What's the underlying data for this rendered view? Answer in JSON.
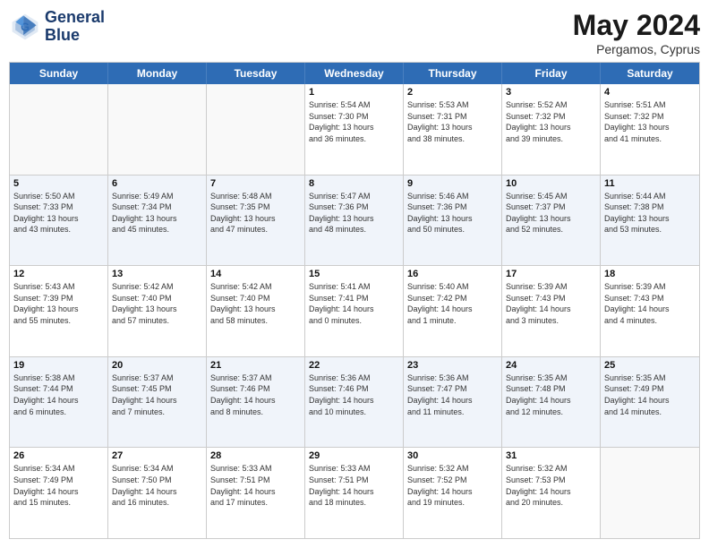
{
  "header": {
    "logo_line1": "General",
    "logo_line2": "Blue",
    "month": "May 2024",
    "location": "Pergamos, Cyprus"
  },
  "day_headers": [
    "Sunday",
    "Monday",
    "Tuesday",
    "Wednesday",
    "Thursday",
    "Friday",
    "Saturday"
  ],
  "weeks": [
    [
      {
        "day": "",
        "info": "",
        "empty": true
      },
      {
        "day": "",
        "info": "",
        "empty": true
      },
      {
        "day": "",
        "info": "",
        "empty": true
      },
      {
        "day": "1",
        "info": "Sunrise: 5:54 AM\nSunset: 7:30 PM\nDaylight: 13 hours\nand 36 minutes."
      },
      {
        "day": "2",
        "info": "Sunrise: 5:53 AM\nSunset: 7:31 PM\nDaylight: 13 hours\nand 38 minutes."
      },
      {
        "day": "3",
        "info": "Sunrise: 5:52 AM\nSunset: 7:32 PM\nDaylight: 13 hours\nand 39 minutes."
      },
      {
        "day": "4",
        "info": "Sunrise: 5:51 AM\nSunset: 7:32 PM\nDaylight: 13 hours\nand 41 minutes."
      }
    ],
    [
      {
        "day": "5",
        "info": "Sunrise: 5:50 AM\nSunset: 7:33 PM\nDaylight: 13 hours\nand 43 minutes.",
        "shaded": true
      },
      {
        "day": "6",
        "info": "Sunrise: 5:49 AM\nSunset: 7:34 PM\nDaylight: 13 hours\nand 45 minutes.",
        "shaded": true
      },
      {
        "day": "7",
        "info": "Sunrise: 5:48 AM\nSunset: 7:35 PM\nDaylight: 13 hours\nand 47 minutes.",
        "shaded": true
      },
      {
        "day": "8",
        "info": "Sunrise: 5:47 AM\nSunset: 7:36 PM\nDaylight: 13 hours\nand 48 minutes.",
        "shaded": true
      },
      {
        "day": "9",
        "info": "Sunrise: 5:46 AM\nSunset: 7:36 PM\nDaylight: 13 hours\nand 50 minutes.",
        "shaded": true
      },
      {
        "day": "10",
        "info": "Sunrise: 5:45 AM\nSunset: 7:37 PM\nDaylight: 13 hours\nand 52 minutes.",
        "shaded": true
      },
      {
        "day": "11",
        "info": "Sunrise: 5:44 AM\nSunset: 7:38 PM\nDaylight: 13 hours\nand 53 minutes.",
        "shaded": true
      }
    ],
    [
      {
        "day": "12",
        "info": "Sunrise: 5:43 AM\nSunset: 7:39 PM\nDaylight: 13 hours\nand 55 minutes."
      },
      {
        "day": "13",
        "info": "Sunrise: 5:42 AM\nSunset: 7:40 PM\nDaylight: 13 hours\nand 57 minutes."
      },
      {
        "day": "14",
        "info": "Sunrise: 5:42 AM\nSunset: 7:40 PM\nDaylight: 13 hours\nand 58 minutes."
      },
      {
        "day": "15",
        "info": "Sunrise: 5:41 AM\nSunset: 7:41 PM\nDaylight: 14 hours\nand 0 minutes."
      },
      {
        "day": "16",
        "info": "Sunrise: 5:40 AM\nSunset: 7:42 PM\nDaylight: 14 hours\nand 1 minute."
      },
      {
        "day": "17",
        "info": "Sunrise: 5:39 AM\nSunset: 7:43 PM\nDaylight: 14 hours\nand 3 minutes."
      },
      {
        "day": "18",
        "info": "Sunrise: 5:39 AM\nSunset: 7:43 PM\nDaylight: 14 hours\nand 4 minutes."
      }
    ],
    [
      {
        "day": "19",
        "info": "Sunrise: 5:38 AM\nSunset: 7:44 PM\nDaylight: 14 hours\nand 6 minutes.",
        "shaded": true
      },
      {
        "day": "20",
        "info": "Sunrise: 5:37 AM\nSunset: 7:45 PM\nDaylight: 14 hours\nand 7 minutes.",
        "shaded": true
      },
      {
        "day": "21",
        "info": "Sunrise: 5:37 AM\nSunset: 7:46 PM\nDaylight: 14 hours\nand 8 minutes.",
        "shaded": true
      },
      {
        "day": "22",
        "info": "Sunrise: 5:36 AM\nSunset: 7:46 PM\nDaylight: 14 hours\nand 10 minutes.",
        "shaded": true
      },
      {
        "day": "23",
        "info": "Sunrise: 5:36 AM\nSunset: 7:47 PM\nDaylight: 14 hours\nand 11 minutes.",
        "shaded": true
      },
      {
        "day": "24",
        "info": "Sunrise: 5:35 AM\nSunset: 7:48 PM\nDaylight: 14 hours\nand 12 minutes.",
        "shaded": true
      },
      {
        "day": "25",
        "info": "Sunrise: 5:35 AM\nSunset: 7:49 PM\nDaylight: 14 hours\nand 14 minutes.",
        "shaded": true
      }
    ],
    [
      {
        "day": "26",
        "info": "Sunrise: 5:34 AM\nSunset: 7:49 PM\nDaylight: 14 hours\nand 15 minutes."
      },
      {
        "day": "27",
        "info": "Sunrise: 5:34 AM\nSunset: 7:50 PM\nDaylight: 14 hours\nand 16 minutes."
      },
      {
        "day": "28",
        "info": "Sunrise: 5:33 AM\nSunset: 7:51 PM\nDaylight: 14 hours\nand 17 minutes."
      },
      {
        "day": "29",
        "info": "Sunrise: 5:33 AM\nSunset: 7:51 PM\nDaylight: 14 hours\nand 18 minutes."
      },
      {
        "day": "30",
        "info": "Sunrise: 5:32 AM\nSunset: 7:52 PM\nDaylight: 14 hours\nand 19 minutes."
      },
      {
        "day": "31",
        "info": "Sunrise: 5:32 AM\nSunset: 7:53 PM\nDaylight: 14 hours\nand 20 minutes."
      },
      {
        "day": "",
        "info": "",
        "empty": true
      }
    ]
  ]
}
